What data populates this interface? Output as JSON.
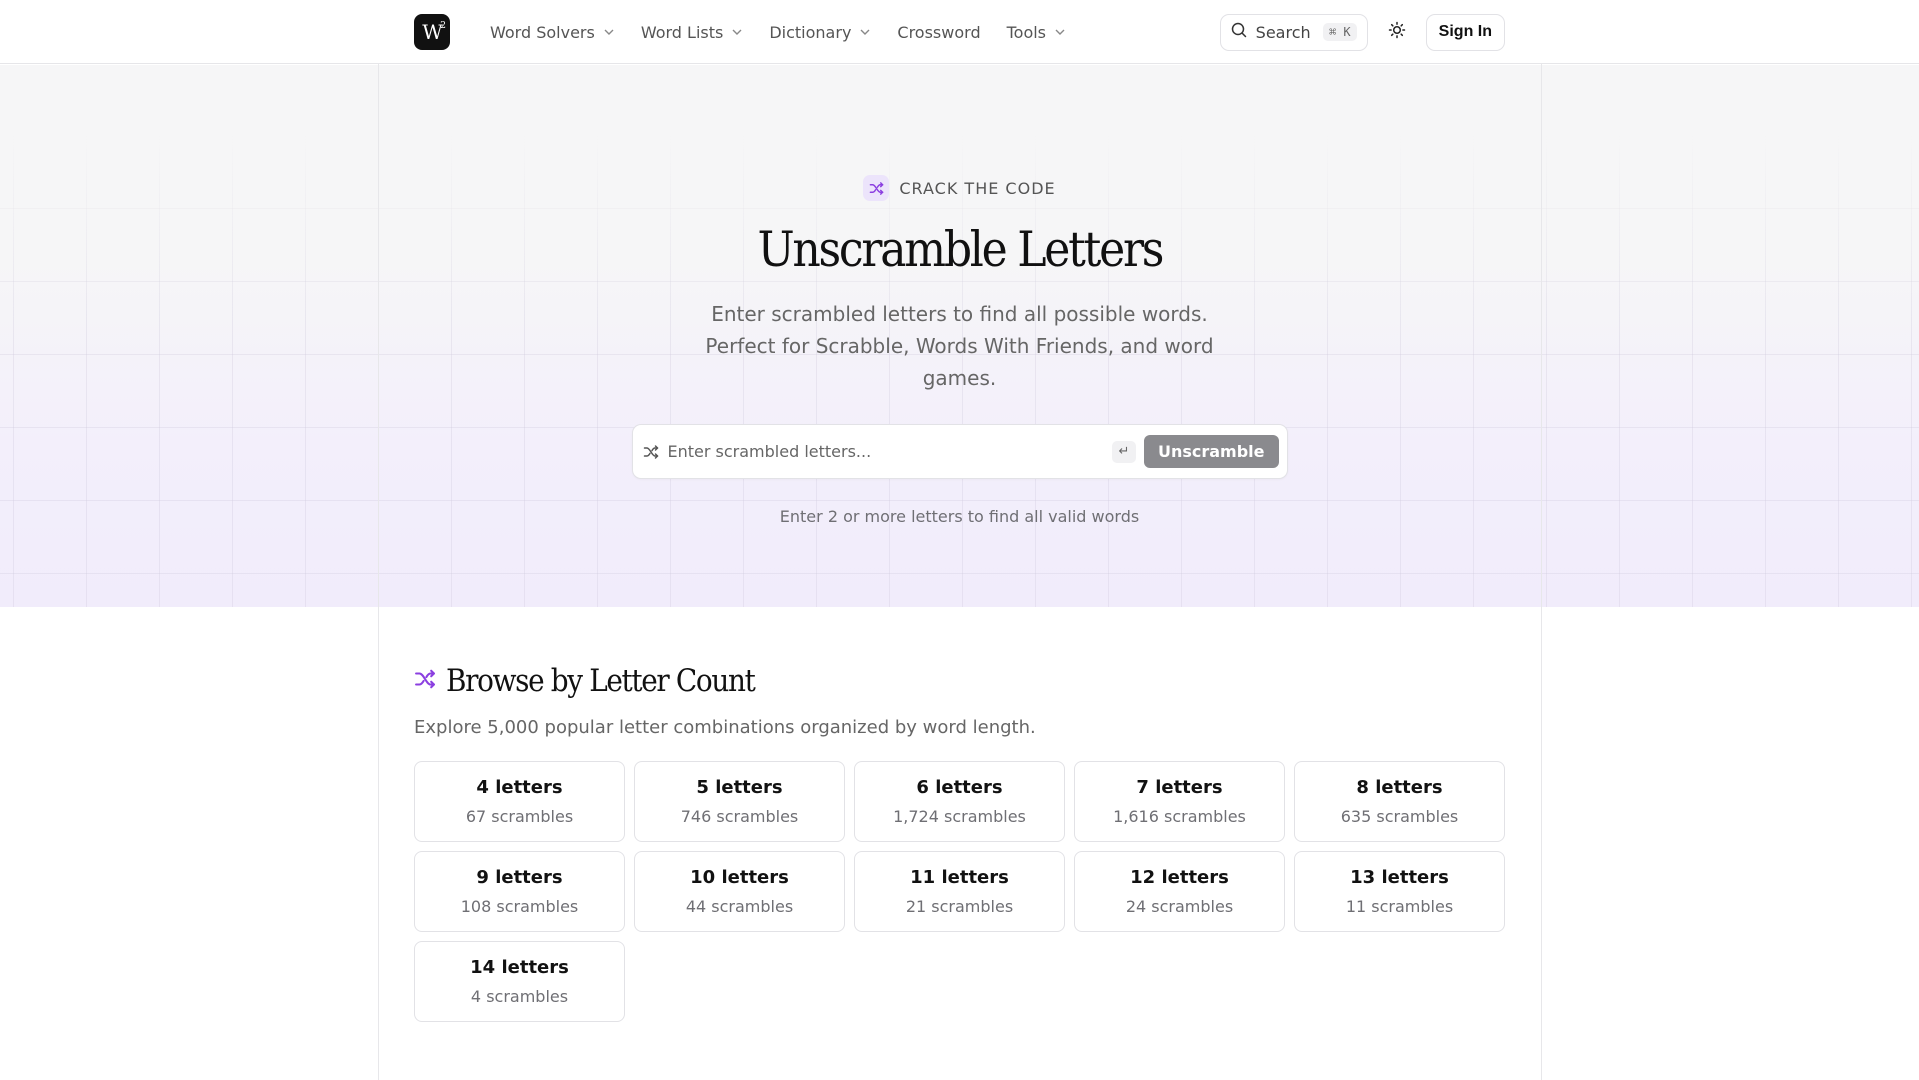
{
  "header": {
    "logo_text": "W",
    "logo_sup": "2",
    "nav": [
      {
        "label": "Word Solvers",
        "dropdown": true
      },
      {
        "label": "Word Lists",
        "dropdown": true
      },
      {
        "label": "Dictionary",
        "dropdown": true
      },
      {
        "label": "Crossword",
        "dropdown": false
      },
      {
        "label": "Tools",
        "dropdown": true
      }
    ],
    "search_label": "Search",
    "search_shortcut": "⌘ K",
    "sign_in_label": "Sign In"
  },
  "hero": {
    "eyebrow": "CRACK THE CODE",
    "title": "Unscramble Letters",
    "subtitle": "Enter scrambled letters to find all possible words. Perfect for Scrabble, Words With Friends, and word games.",
    "input_placeholder": "Enter scrambled letters...",
    "enter_key": "↵",
    "button_label": "Unscramble",
    "hint": "Enter 2 or more letters to find all valid words"
  },
  "browse": {
    "title": "Browse by Letter Count",
    "description": "Explore 5,000 popular letter combinations organized by word length.",
    "cards": [
      {
        "title": "4 letters",
        "sub": "67 scrambles"
      },
      {
        "title": "5 letters",
        "sub": "746 scrambles"
      },
      {
        "title": "6 letters",
        "sub": "1,724 scrambles"
      },
      {
        "title": "7 letters",
        "sub": "1,616 scrambles"
      },
      {
        "title": "8 letters",
        "sub": "635 scrambles"
      },
      {
        "title": "9 letters",
        "sub": "108 scrambles"
      },
      {
        "title": "10 letters",
        "sub": "44 scrambles"
      },
      {
        "title": "11 letters",
        "sub": "21 scrambles"
      },
      {
        "title": "12 letters",
        "sub": "24 scrambles"
      },
      {
        "title": "13 letters",
        "sub": "11 scrambles"
      },
      {
        "title": "14 letters",
        "sub": "4 scrambles"
      }
    ]
  },
  "colors": {
    "accent": "#8b3fe0",
    "button_bg": "#8a8a8e",
    "eyebrow_icon_bg": "#ece4fb"
  },
  "icons": [
    "search-icon",
    "sun-icon",
    "shuffle-icon",
    "chevron-down-icon",
    "enter-key-icon"
  ]
}
